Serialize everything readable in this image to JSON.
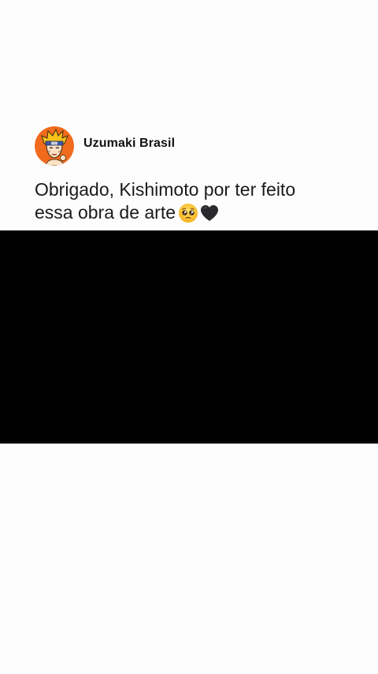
{
  "post": {
    "author": {
      "name": "Uzumaki Brasil",
      "avatar_icon": "naruto-avatar-icon"
    },
    "text_line_1": "Obrigado, Kishimoto por ter feito",
    "text_line_2": "essa obra de arte",
    "emojis": [
      "pleading-face-emoji",
      "black-heart-emoji"
    ]
  },
  "colors": {
    "background": "#fefdfd",
    "text": "#1a1a1a",
    "avatar_bg": "#f26b1d",
    "media_bg": "#000000"
  }
}
